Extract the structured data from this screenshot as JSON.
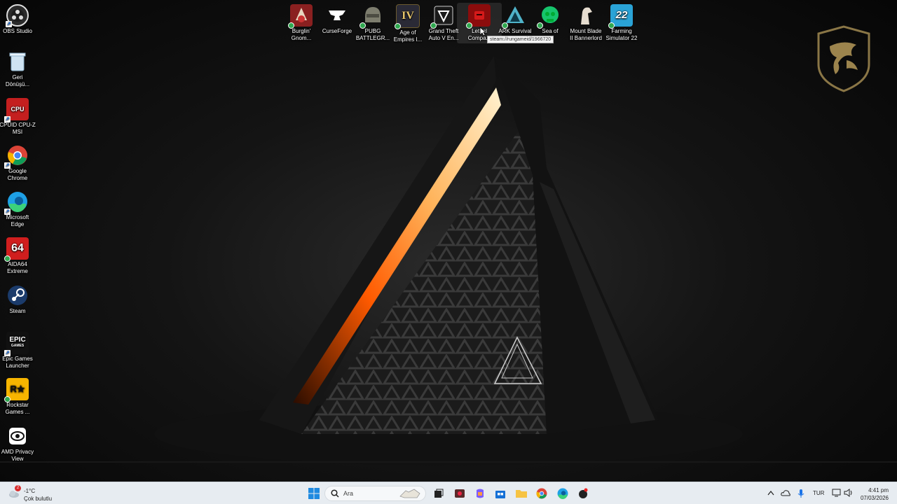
{
  "desktop": {
    "left_icons": [
      {
        "label": "OBS Studio",
        "icon": "obs-icon"
      },
      {
        "label": "Geri\nDönüşü...",
        "icon": "recycle-bin-icon"
      },
      {
        "label": "CPUID CPU-Z\nMSI",
        "icon": "cpuz-icon"
      },
      {
        "label": "Google\nChrome",
        "icon": "chrome-icon"
      },
      {
        "label": "Microsoft\nEdge",
        "icon": "edge-icon"
      },
      {
        "label": "AIDA64\nExtreme",
        "icon": "aida64-icon"
      },
      {
        "label": "Steam",
        "icon": "steam-icon"
      },
      {
        "label": "Epic Games\nLauncher",
        "icon": "epic-games-icon"
      },
      {
        "label": "Rockstar\nGames ...",
        "icon": "rockstar-icon"
      },
      {
        "label": "AMD Privacy\nView",
        "icon": "amd-privacy-icon"
      }
    ],
    "top_icons": [
      {
        "label": "Burglin'\nGnom...",
        "icon": "burglin-gnomes-icon"
      },
      {
        "label": "CurseForge",
        "icon": "curseforge-icon"
      },
      {
        "label": "PUBG\nBATTLEGR...",
        "icon": "pubg-icon"
      },
      {
        "label": "Age of\nEmpires I...",
        "icon": "age-of-empires-icon"
      },
      {
        "label": "Grand Theft\nAuto V En...",
        "icon": "gta-v-icon"
      },
      {
        "label": "Lethal\nCompa...",
        "icon": "lethal-company-icon"
      },
      {
        "label": "ARK Survival",
        "icon": "ark-icon"
      },
      {
        "label": "Sea of",
        "icon": "sea-of-thieves-icon"
      },
      {
        "label": "Mount  Blade\nII Bannerlord",
        "icon": "bannerlord-icon"
      },
      {
        "label": "Farming\nSimulator 22",
        "icon": "farming-sim-icon"
      }
    ],
    "icon_glyphs": {
      "cpuz": "CPU",
      "aida": "64",
      "epic_line1": "EPIC",
      "epic_line2": "GAMES",
      "rockstar": "R★",
      "age_of_empires": "IV",
      "farming": "22"
    },
    "tooltip": "steam://rungameid/1966720"
  },
  "taskbar": {
    "weather": {
      "temp": "-1°C",
      "condition": "Çok bulutlu",
      "badge": "2"
    },
    "search_placeholder": "Ara",
    "apps": [
      "start-icon",
      "search-icon",
      "task-view-icon",
      "app-icon",
      "copilot-icon",
      "store-icon",
      "file-explorer-icon",
      "chrome-icon",
      "edge-icon",
      "media-icon"
    ],
    "tray": {
      "language": "TUR"
    },
    "clock": {
      "time": "4:41 pm",
      "date": "07/03/2026"
    }
  },
  "colors": {
    "taskbar_bg": "#e7ecf1",
    "orange_glow": "#ff7a1a",
    "msi_gold": "#b59a5b"
  }
}
